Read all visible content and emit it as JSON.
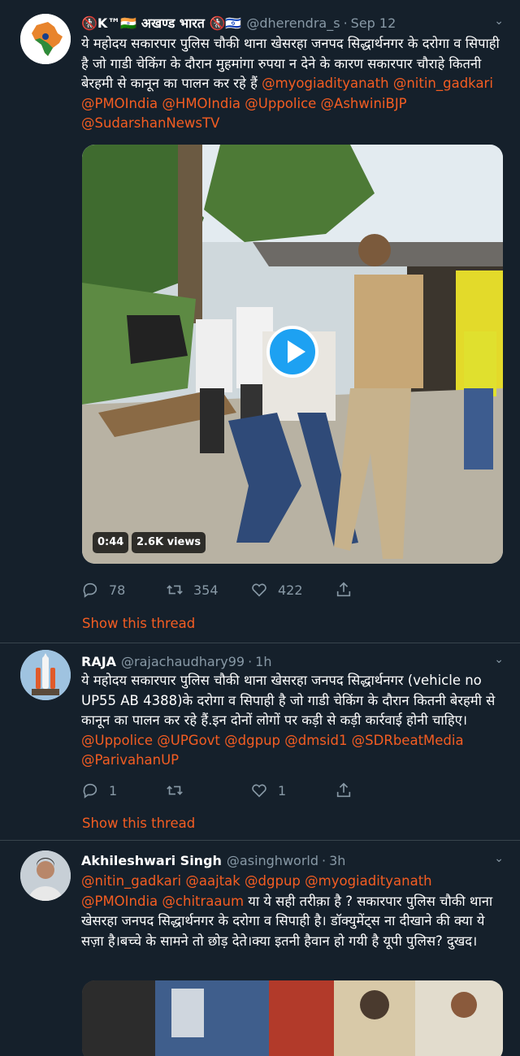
{
  "tweets": [
    {
      "display_name": "🚷K™🇮🇳 अखण्ड भारत 🚷🇮🇱",
      "handle": "@dherendra_s",
      "time": "Sep 12",
      "text": "ये महोदय सकारपार पुलिस चौकी थाना खेसरहा जनपद सिद्धार्थनगर के दरोगा व सिपाही है जो गाडी चेकिंग के दौरान मुहमांगा रुपया न देने के कारण सकारपार चौराहे कितनी बेरहमी से कानून का पालन कर रहे हैं",
      "mentions": "@myogiadityanath @nitin_gadkari @PMOIndia @HMOIndia @Uppolice @AshwiniBJP @SudarshanNewsTV",
      "video_duration": "0:44",
      "video_views": "2.6K views",
      "replies": "78",
      "retweets": "354",
      "likes": "422",
      "thread_link": "Show this thread"
    },
    {
      "display_name": "RAJA",
      "handle": "@rajachaudhary99",
      "time": "1h",
      "text": "ये महोदय सकारपार पुलिस चौकी थाना खेसरहा जनपद सिद्धार्थनगर (vehicle no UP55 AB 4388)के दरोगा व सिपाही है जो गाडी चेकिंग के दौरान कितनी बेरहमी से कानून का पालन कर रहे हैं.इन दोनों लोगों पर कड़ी से कड़ी कार्रवाई होनी चाहिए।",
      "mentions": "@Uppolice @UPGovt @dgpup @dmsid1 @SDRbeatMedia @ParivahanUP",
      "replies": "1",
      "retweets": "",
      "likes": "1",
      "thread_link": "Show this thread"
    },
    {
      "display_name": "Akhileshwari Singh",
      "handle": "@asinghworld",
      "time": "3h",
      "mentions": "@nitin_gadkari @aajtak @dgpup @myogiadityanath @PMOIndia @chitraaum",
      "text": "या ये सही तरीक़ा है ? सकारपार पुलिस चौकी थाना खेसरहा जनपद सिद्धार्थनगर के दरोगा व सिपाही है। डॉक्युमेंट्स ना दीखाने की क्या ये सज़ा है।बच्चे के सामने तो छोड़ देते।क्या इतनी हैवान हो गयी है यूपी पुलिस? दुखद।"
    }
  ],
  "colors": {
    "background": "#15202b",
    "text": "#ffffff",
    "muted": "#8899a6",
    "mention": "#f45d22",
    "divider": "#38444d",
    "play_button": "#1da1f2"
  },
  "icons": [
    "reply-icon",
    "retweet-icon",
    "like-icon",
    "share-icon",
    "play-icon",
    "chevron-down-icon"
  ]
}
